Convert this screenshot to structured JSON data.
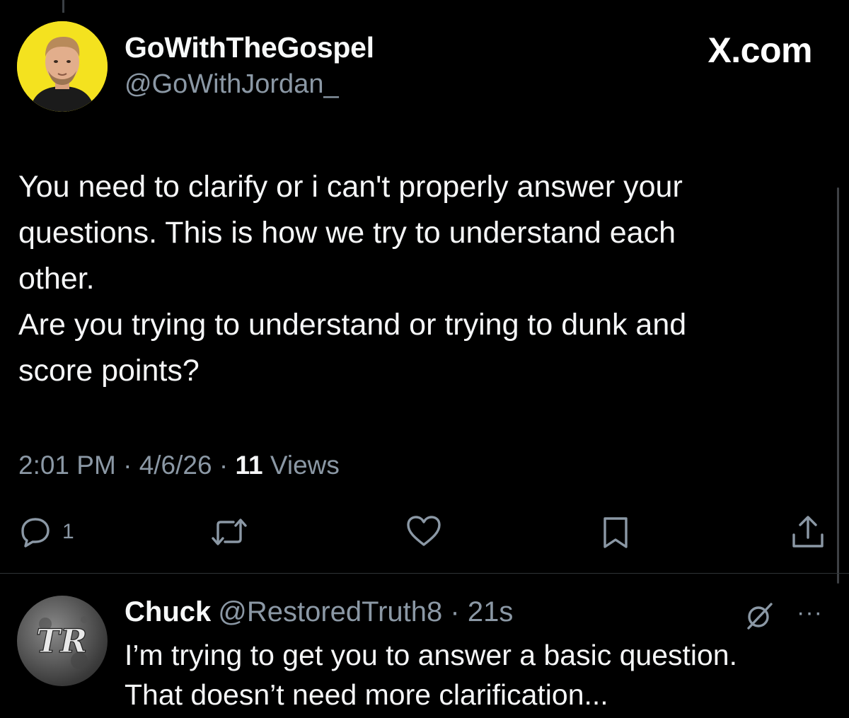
{
  "tweet": {
    "author": {
      "display_name": "GoWithTheGospel",
      "handle": "@GoWithJordan_",
      "avatar_icon": "profile-photo"
    },
    "brand": "X.com",
    "text": "You need to clarify or i can't properly answer your\nquestions. This is how we try to understand each\nother.\nAre you trying to understand or trying to dunk and\nscore points?",
    "time": "2:01 PM",
    "date": "4/6/26",
    "views_count": "11",
    "views_label": "Views",
    "reply_count": "1",
    "icons": {
      "reply": "speech-bubble-icon",
      "repost": "repost-arrows-icon",
      "like": "heart-icon",
      "bookmark": "bookmark-icon",
      "share": "share-upload-icon"
    }
  },
  "reply": {
    "display_name": "Chuck",
    "handle": "@RestoredTruth8",
    "age": "21s",
    "avatar_monogram": "TR",
    "text": "I’m trying to get you to answer a basic question.\nThat doesn’t need more clarification...",
    "more_glyph": "···",
    "icons": {
      "grok": "slash-circle-icon",
      "more": "more-dots-icon"
    }
  },
  "colors": {
    "background": "#000000",
    "primary_text": "#e7e9ea",
    "secondary_text": "#8b98a5",
    "divider": "#2f3336",
    "avatar_background": "#f4e21f"
  }
}
